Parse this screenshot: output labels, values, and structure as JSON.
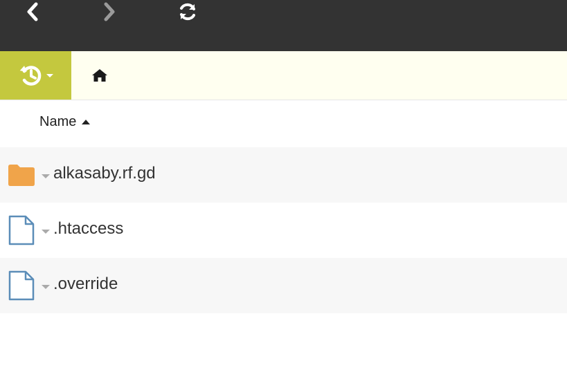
{
  "toolbar": {
    "back": {
      "icon": "chevron-left-icon",
      "color": "#ffffff"
    },
    "forward": {
      "icon": "chevron-right-icon",
      "color": "#9a9a9a"
    },
    "refresh": {
      "icon": "refresh-icon",
      "color": "#ffffff"
    },
    "background": "#333333"
  },
  "pathbar": {
    "history_icon": "history-icon",
    "history_bg": "#c4c83e",
    "home_icon": "home-icon",
    "background": "#fffff0"
  },
  "table": {
    "header": {
      "name_label": "Name",
      "sort": "ascending"
    },
    "rows": [
      {
        "name": "alkasaby.rf.gd",
        "type": "folder",
        "icon": "folder-icon"
      },
      {
        "name": ".htaccess",
        "type": "file",
        "icon": "file-icon"
      },
      {
        "name": ".override",
        "type": "file",
        "icon": "file-icon"
      }
    ]
  },
  "colors": {
    "folder": "#f0a44a",
    "file_outline": "#5b8db8"
  }
}
